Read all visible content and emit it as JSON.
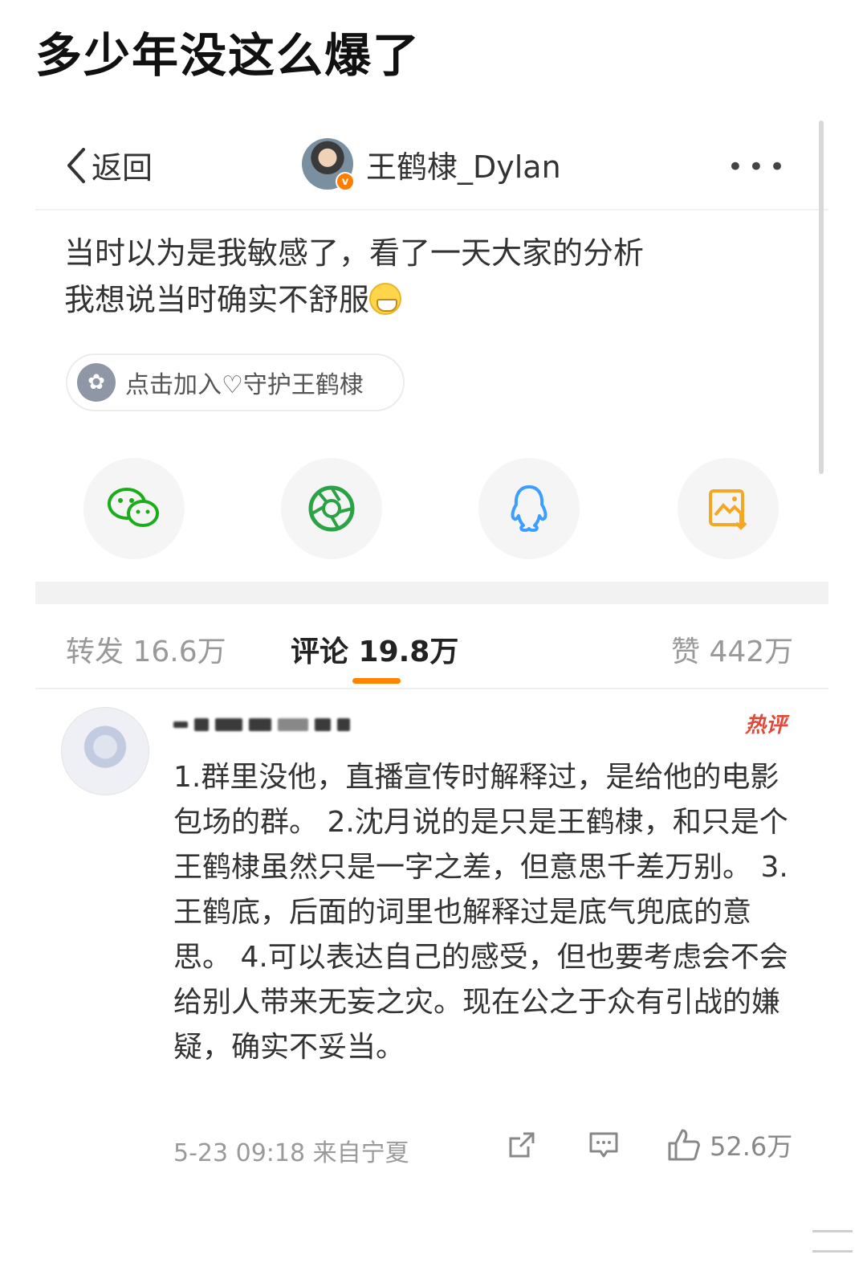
{
  "page_title": "多少年没这么爆了",
  "header": {
    "back_label": "返回",
    "username": "王鹤棣_Dylan",
    "verified_badge": "v",
    "more_label": "•••"
  },
  "post": {
    "line1": "当时以为是我敏感了，看了一天大家的分析",
    "line2": "我想说当时确实不舒服"
  },
  "tag": {
    "label": "点击加入♡守护王鹤棣",
    "icon": "flower-icon"
  },
  "share_buttons": [
    {
      "name": "wechat",
      "icon": "wechat-icon",
      "color": "#1aad19"
    },
    {
      "name": "moments",
      "icon": "moments-icon",
      "color": "#2ba245"
    },
    {
      "name": "qq",
      "icon": "qq-icon",
      "color": "#3d9eff"
    },
    {
      "name": "save-image",
      "icon": "image-download-icon",
      "color": "#f5a623"
    }
  ],
  "tabs": {
    "repost": "转发 16.6万",
    "comments": "评论 19.8万",
    "likes": "赞 442万",
    "active": "comments",
    "indicator_color": "#ff8200"
  },
  "comment": {
    "hot_label": "热评",
    "text": "1.群里没他，直播宣传时解释过，是给他的电影包场的群。 2.沈月说的是只是王鹤棣，和只是个王鹤棣虽然只是一字之差，但意思千差万别。 3.王鹤底，后面的词里也解释过是底气兜底的意思。 4.可以表达自己的感受，但也要考虑会不会给别人带来无妄之灾。现在公之于众有引战的嫌疑，确实不妥当。",
    "meta": "5-23 09:18 来自宁夏",
    "like_count": "52.6万"
  }
}
